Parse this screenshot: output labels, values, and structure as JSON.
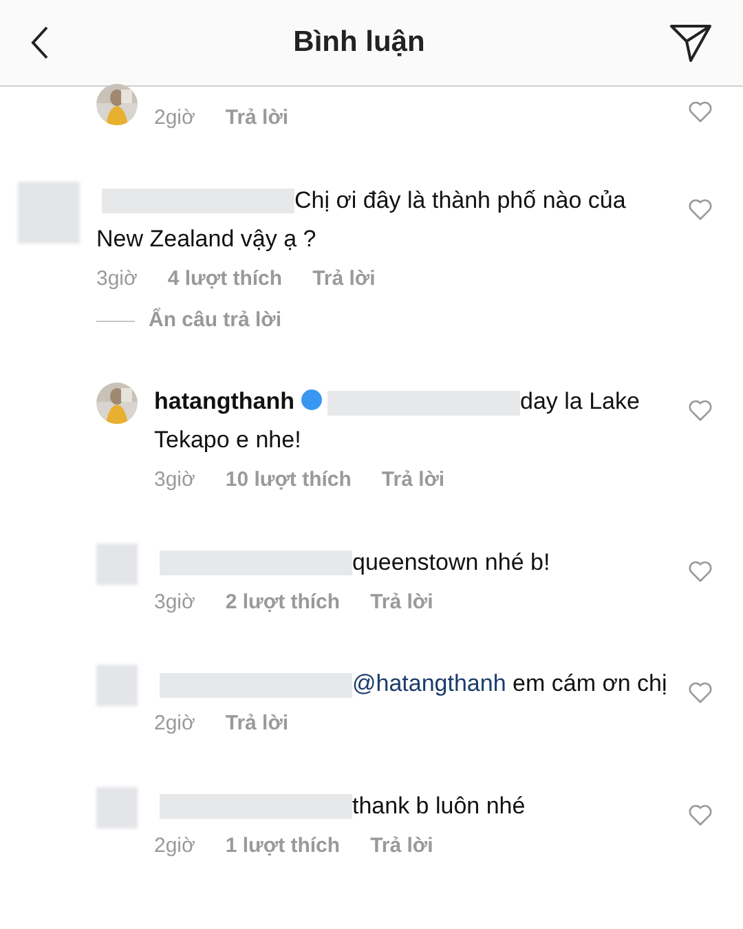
{
  "header": {
    "title": "Bình luận"
  },
  "items": [
    {
      "kind": "reply",
      "time": "2giờ",
      "reply": "Trả lời"
    },
    {
      "kind": "comment",
      "avatar": {
        "kind": "blurred"
      },
      "redacted": true,
      "text": "Chị ơi đây là thành phố nào của New Zealand vậy ạ ?",
      "time": "3giờ",
      "likes": "4 lượt thích",
      "reply": "Trả lời"
    },
    {
      "kind": "toggle",
      "label": "Ẩn câu trả lời"
    },
    {
      "kind": "reply",
      "username": "hatangthanh",
      "verified": true,
      "redacted": true,
      "text": "day la Lake Tekapo e nhe!",
      "time": "3giờ",
      "likes": "10 lượt thích",
      "reply": "Trả lời"
    },
    {
      "kind": "reply",
      "avatar": {
        "kind": "blurred"
      },
      "redacted": true,
      "text": "queenstown nhé b!",
      "time": "3giờ",
      "likes": "2 lượt thích",
      "reply": "Trả lời"
    },
    {
      "kind": "reply",
      "avatar": {
        "kind": "blurred"
      },
      "redacted": true,
      "mention": "@hatangthanh",
      "text": "em cám ơn chị",
      "time": "2giờ",
      "reply": "Trả lời"
    },
    {
      "kind": "reply",
      "avatar": {
        "kind": "blurred"
      },
      "redacted": true,
      "text": "thank b luôn nhé",
      "time": "2giờ",
      "likes": "1 lượt thích",
      "reply": "Trả lời"
    }
  ]
}
